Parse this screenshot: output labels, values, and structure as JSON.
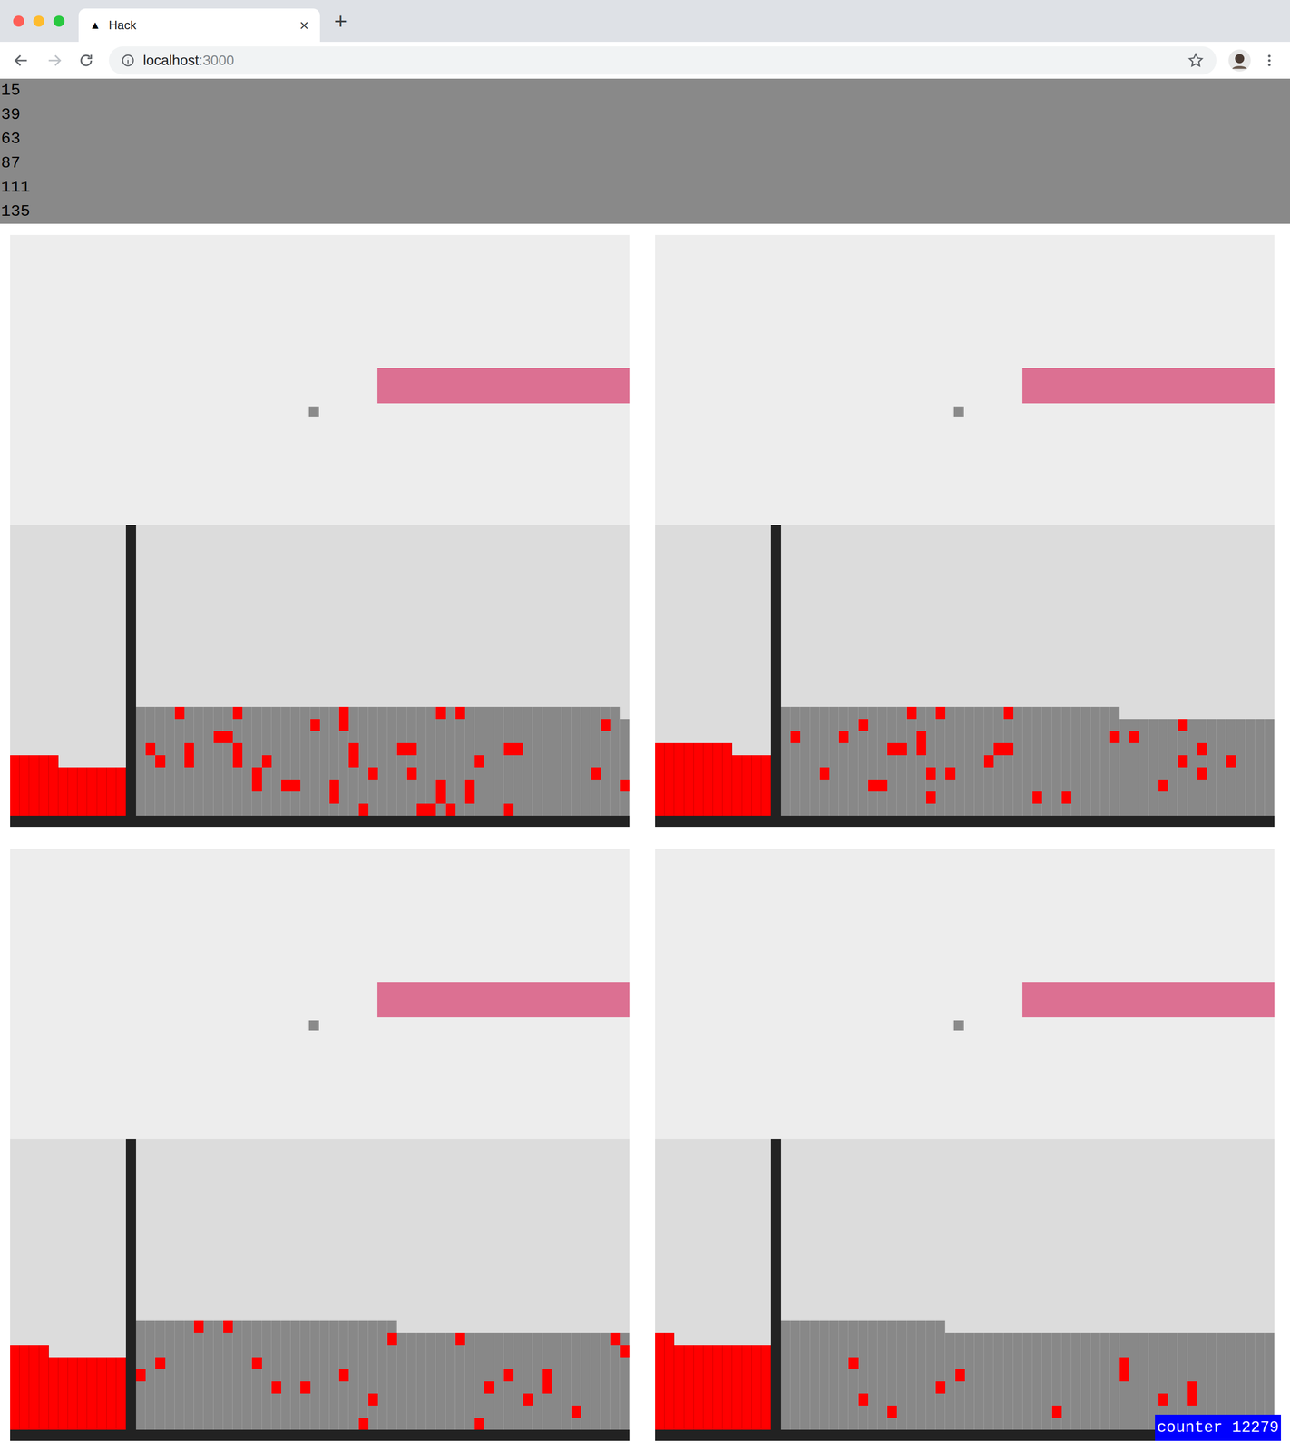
{
  "browser": {
    "tab": {
      "favicon": "▲",
      "title": "Hack",
      "close": "×",
      "selected": true
    },
    "new_tab": "+",
    "forward_enabled": false,
    "address": {
      "host": "localhost",
      "port": ":3000"
    }
  },
  "log": [
    "15",
    "39",
    "63",
    "87",
    "111",
    "135"
  ],
  "panels": [
    {
      "left_heights": [
        5,
        5,
        5,
        5,
        5,
        4,
        4,
        4,
        4,
        4,
        4,
        4
      ],
      "right_heights": [
        9,
        9,
        9,
        9,
        9,
        9,
        9,
        9,
        9,
        9,
        9,
        9,
        9,
        9,
        9,
        9,
        9,
        9,
        9,
        9,
        9,
        9,
        9,
        9,
        9,
        9,
        9,
        9,
        9,
        9,
        9,
        9,
        9,
        9,
        9,
        9,
        9,
        9,
        9,
        9,
        9,
        9,
        9,
        9,
        9,
        9,
        9,
        9,
        9,
        9,
        8
      ],
      "red_cells": [
        [
          4,
          8
        ],
        [
          10,
          8
        ],
        [
          21,
          8
        ],
        [
          21,
          7
        ],
        [
          31,
          8
        ],
        [
          33,
          8
        ],
        [
          18,
          7
        ],
        [
          48,
          7
        ],
        [
          8,
          6
        ],
        [
          9,
          6
        ],
        [
          1,
          5
        ],
        [
          2,
          4
        ],
        [
          5,
          5
        ],
        [
          5,
          4
        ],
        [
          10,
          5
        ],
        [
          10,
          4
        ],
        [
          13,
          4
        ],
        [
          12,
          3
        ],
        [
          12,
          2
        ],
        [
          22,
          5
        ],
        [
          22,
          4
        ],
        [
          24,
          3
        ],
        [
          27,
          5
        ],
        [
          28,
          5
        ],
        [
          28,
          3
        ],
        [
          35,
          4
        ],
        [
          38,
          5
        ],
        [
          39,
          5
        ],
        [
          47,
          3
        ],
        [
          15,
          2
        ],
        [
          16,
          2
        ],
        [
          20,
          2
        ],
        [
          20,
          1
        ],
        [
          31,
          2
        ],
        [
          31,
          1
        ],
        [
          34,
          2
        ],
        [
          34,
          1
        ],
        [
          50,
          2
        ],
        [
          23,
          0
        ],
        [
          29,
          0
        ],
        [
          30,
          0
        ],
        [
          32,
          0
        ],
        [
          38,
          0
        ]
      ]
    },
    {
      "left_heights": [
        6,
        6,
        6,
        6,
        6,
        6,
        6,
        6,
        5,
        5,
        5,
        5
      ],
      "right_heights": [
        9,
        9,
        9,
        9,
        9,
        9,
        9,
        9,
        9,
        9,
        9,
        9,
        9,
        9,
        9,
        9,
        9,
        9,
        9,
        9,
        9,
        9,
        9,
        9,
        9,
        9,
        9,
        9,
        9,
        9,
        9,
        9,
        9,
        9,
        9,
        8,
        8,
        8,
        8,
        8,
        8,
        8,
        8,
        8,
        8,
        8,
        8,
        8,
        8,
        8,
        8
      ],
      "red_cells": [
        [
          13,
          8
        ],
        [
          16,
          8
        ],
        [
          23,
          8
        ],
        [
          8,
          7
        ],
        [
          41,
          7
        ],
        [
          1,
          6
        ],
        [
          6,
          6
        ],
        [
          14,
          6
        ],
        [
          14,
          5
        ],
        [
          34,
          6
        ],
        [
          36,
          6
        ],
        [
          11,
          5
        ],
        [
          12,
          5
        ],
        [
          22,
          5
        ],
        [
          23,
          5
        ],
        [
          43,
          5
        ],
        [
          21,
          4
        ],
        [
          41,
          4
        ],
        [
          46,
          4
        ],
        [
          4,
          3
        ],
        [
          15,
          3
        ],
        [
          17,
          3
        ],
        [
          43,
          3
        ],
        [
          9,
          2
        ],
        [
          10,
          2
        ],
        [
          39,
          2
        ],
        [
          15,
          1
        ],
        [
          26,
          1
        ],
        [
          29,
          1
        ]
      ]
    },
    {
      "left_heights": [
        7,
        7,
        7,
        7,
        6,
        6,
        6,
        6,
        6,
        6,
        6,
        6
      ],
      "right_heights": [
        9,
        9,
        9,
        9,
        9,
        9,
        9,
        9,
        9,
        9,
        9,
        9,
        9,
        9,
        9,
        9,
        9,
        9,
        9,
        9,
        9,
        9,
        9,
        9,
        9,
        9,
        9,
        8,
        8,
        8,
        8,
        8,
        8,
        8,
        8,
        8,
        8,
        8,
        8,
        8,
        8,
        8,
        8,
        8,
        8,
        8,
        8,
        8,
        8,
        8,
        8
      ],
      "red_cells": [
        [
          6,
          8
        ],
        [
          9,
          8
        ],
        [
          26,
          7
        ],
        [
          33,
          7
        ],
        [
          49,
          7
        ],
        [
          50,
          6
        ],
        [
          2,
          5
        ],
        [
          12,
          5
        ],
        [
          0,
          4
        ],
        [
          21,
          4
        ],
        [
          38,
          4
        ],
        [
          42,
          4
        ],
        [
          42,
          3
        ],
        [
          14,
          3
        ],
        [
          17,
          3
        ],
        [
          36,
          3
        ],
        [
          40,
          2
        ],
        [
          24,
          2
        ],
        [
          45,
          1
        ],
        [
          23,
          0
        ],
        [
          35,
          0
        ]
      ]
    },
    {
      "left_heights": [
        8,
        8,
        7,
        7,
        7,
        7,
        7,
        7,
        7,
        7,
        7,
        7
      ],
      "right_heights": [
        9,
        9,
        9,
        9,
        9,
        9,
        9,
        9,
        9,
        9,
        9,
        9,
        9,
        9,
        9,
        9,
        9,
        8,
        8,
        8,
        8,
        8,
        8,
        8,
        8,
        8,
        8,
        8,
        8,
        8,
        8,
        8,
        8,
        8,
        8,
        8,
        8,
        8,
        8,
        8,
        8,
        8,
        8,
        8,
        8,
        8,
        8,
        8,
        8,
        8,
        8
      ],
      "red_cells": [
        [
          7,
          5
        ],
        [
          35,
          5
        ],
        [
          35,
          4
        ],
        [
          18,
          4
        ],
        [
          16,
          3
        ],
        [
          42,
          3
        ],
        [
          42,
          2
        ],
        [
          8,
          2
        ],
        [
          39,
          2
        ],
        [
          11,
          1
        ],
        [
          28,
          1
        ]
      ]
    }
  ],
  "counter": {
    "label": "counter 12279"
  }
}
